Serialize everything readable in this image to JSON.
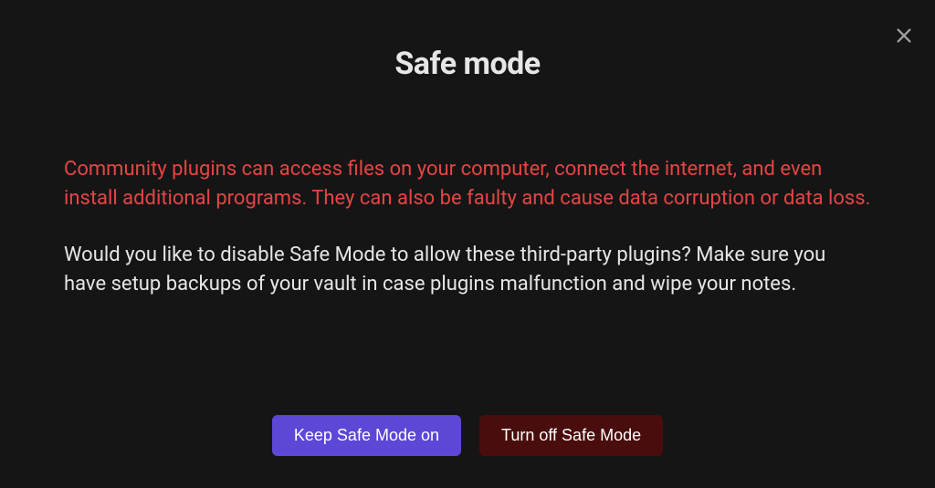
{
  "modal": {
    "title": "Safe mode",
    "warning": "Community plugins can access files on your computer, connect the internet, and even install additional programs. They can also be faulty and cause data corruption or data loss.",
    "description": "Would you like to disable Safe Mode to allow these third-party plugins? Make sure you have setup backups of your vault in case plugins malfunction and wipe your notes.",
    "buttons": {
      "keep": "Keep Safe Mode on",
      "turnOff": "Turn off Safe Mode"
    }
  }
}
